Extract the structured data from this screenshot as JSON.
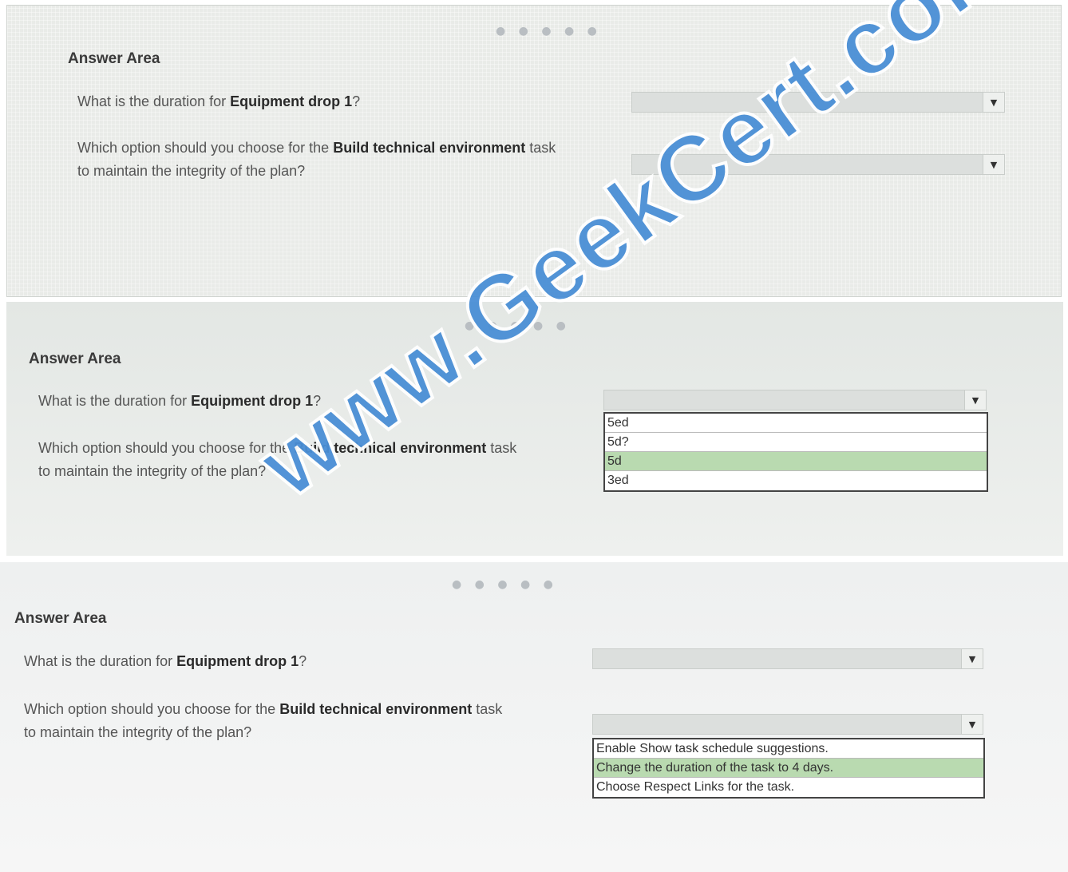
{
  "panels": [
    {
      "heading": "Answer Area",
      "q1": {
        "pre": "What is the duration for ",
        "bold": "Equipment drop 1",
        "post": "?"
      },
      "q2": {
        "pre": "Which option should you choose for the ",
        "bold": "Build technical environment",
        "post": " task",
        "line2": "to maintain the integrity of the plan?"
      }
    },
    {
      "heading": "Answer Area",
      "q1": {
        "pre": "What is the duration for ",
        "bold": "Equipment drop 1",
        "post": "?"
      },
      "q2": {
        "pre": "Which option should you choose for the ",
        "bold": "Build technical environment",
        "post": " task",
        "line2": "to maintain the integrity of the plan?"
      },
      "dropdown_options": [
        "5ed",
        "5d?",
        "5d",
        "3ed"
      ],
      "selected_option": "5d"
    },
    {
      "heading": "Answer Area",
      "q1": {
        "pre": "What is the duration for ",
        "bold": "Equipment drop 1",
        "post": "?"
      },
      "q2": {
        "pre": "Which option should you choose for the ",
        "bold": "Build technical environment",
        "post": " task",
        "line2": "to maintain the integrity of the plan?"
      },
      "dropdown_options": [
        "Enable Show task schedule suggestions.",
        "Change the duration of the task to 4 days.",
        "Choose Respect Links for the task."
      ],
      "selected_option": "Change the duration of the task to 4 days."
    }
  ],
  "dots": "● ● ● ● ●",
  "arrow_icon": "▼",
  "watermark": "www.GeekCert.com"
}
